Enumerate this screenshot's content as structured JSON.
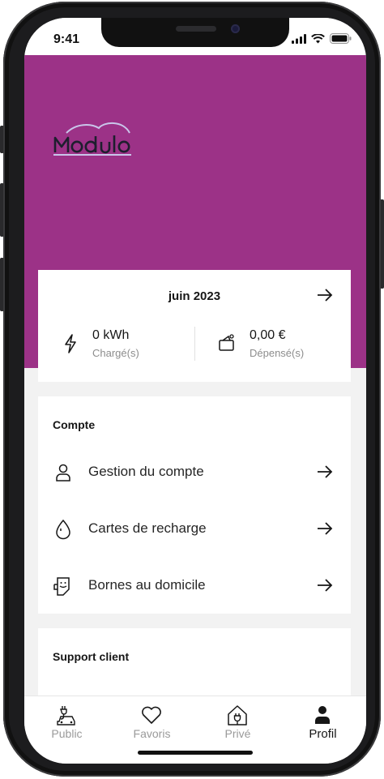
{
  "status": {
    "time": "9:41"
  },
  "brand": {
    "logo_text": "Modulo",
    "accent": "#9c3287"
  },
  "summary": {
    "month": "juin 2023",
    "energy_value": "0 kWh",
    "energy_label": "Chargé(s)",
    "spent_value": "0,00 €",
    "spent_label": "Dépensé(s)"
  },
  "account": {
    "title": "Compte",
    "items": [
      {
        "label": "Gestion du compte",
        "icon": "user-icon"
      },
      {
        "label": "Cartes de recharge",
        "icon": "charge-card-icon"
      },
      {
        "label": "Bornes au domicile",
        "icon": "home-charger-icon"
      }
    ]
  },
  "support": {
    "title": "Support client"
  },
  "tabs": [
    {
      "label": "Public",
      "icon": "public-charging-icon",
      "active": false
    },
    {
      "label": "Favoris",
      "icon": "heart-icon",
      "active": false
    },
    {
      "label": "Privé",
      "icon": "private-home-icon",
      "active": false
    },
    {
      "label": "Profil",
      "icon": "profile-icon",
      "active": true
    }
  ]
}
